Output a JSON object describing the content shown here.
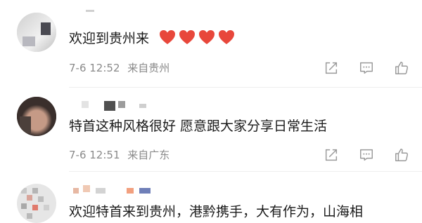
{
  "comments": [
    {
      "text": "欢迎到贵州来",
      "emoji": "heart",
      "emoji_count": 4,
      "time": "7-6 12:52",
      "location": "来自贵州"
    },
    {
      "text": "特首这种风格很好 愿意跟大家分享日常生活",
      "time": "7-6 12:51",
      "location": "来自广东"
    },
    {
      "text": "欢迎特首来到贵州，港黔携手，大有作为，山海相"
    }
  ],
  "icons": {
    "share": "share-icon",
    "comment": "comment-icon",
    "like": "thumbs-up-icon"
  },
  "colors": {
    "heart": "#e8473b",
    "meta_text": "#8a8a8a",
    "icon": "#9a9a9a"
  }
}
